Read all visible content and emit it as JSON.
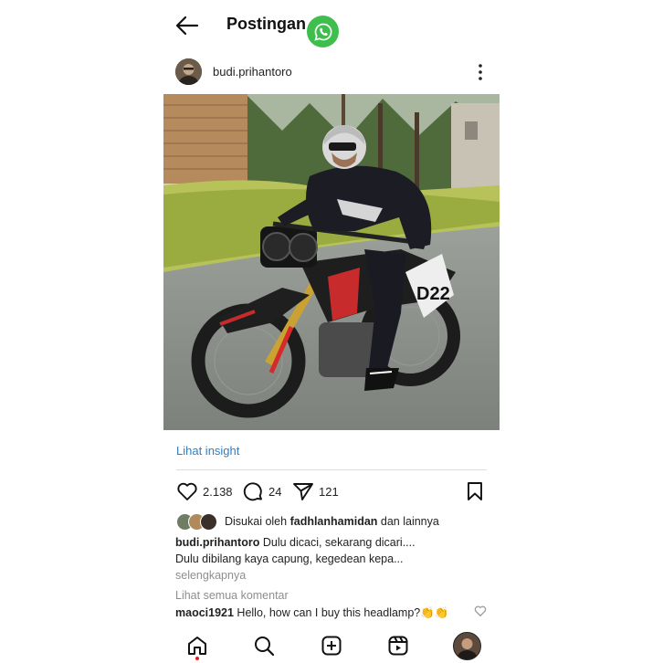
{
  "header": {
    "title": "Postingan"
  },
  "post": {
    "username": "budi.prihantoro",
    "insight_link": "Lihat insight",
    "likes_count": "2.138",
    "comments_count": "24",
    "shares_count": "121",
    "liked_by_prefix": "Disukai oleh ",
    "liked_by_user": "fadhlanhamidan",
    "liked_by_suffix": " dan lainnya",
    "caption_line1": "Dulu dicaci, sekarang dicari....",
    "caption_line2": "Dulu dibilang kaya capung, kegedean kepa...",
    "more_label": "selengkapnya",
    "view_all_comments": "Lihat semua komentar",
    "comment": {
      "user": "maoci1921",
      "text": "Hello, how can I buy this headlamp?👏👏"
    },
    "photo": {
      "plate_number": "D22"
    }
  },
  "icons": {
    "back": "arrow-left-icon",
    "whatsapp": "whatsapp-icon",
    "more": "more-vertical-icon",
    "like": "heart-icon",
    "comment": "comment-icon",
    "share": "send-icon",
    "bookmark": "bookmark-icon",
    "home": "home-icon",
    "search": "search-icon",
    "add": "add-post-icon",
    "reels": "reels-icon"
  },
  "colors": {
    "link": "#2e7ec6",
    "whatsapp": "#3dbe4d",
    "muted": "#8e8e8e"
  }
}
